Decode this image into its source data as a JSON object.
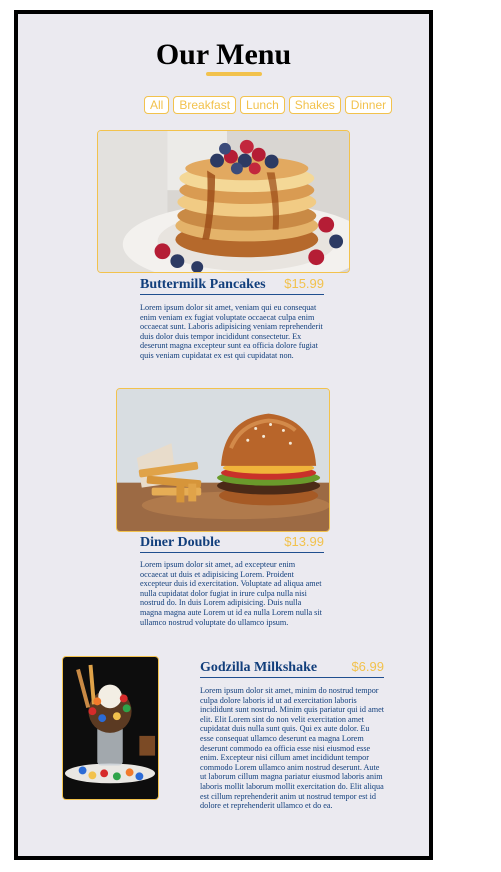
{
  "menu": {
    "title": "Our Menu",
    "filters": [
      "All",
      "Breakfast",
      "Lunch",
      "Shakes",
      "Dinner"
    ],
    "items": [
      {
        "name": "Buttermilk Pancakes",
        "price": "$15.99",
        "image": "pancakes-photo",
        "description": "Lorem ipsum dolor sit amet, veniam qui eu consequat enim veniam ex fugiat voluptate occaecat culpa enim occaecat sunt. Laboris adipisicing veniam reprehenderit duis dolor duis tempor incididunt consectetur. Ex deserunt magna excepteur sunt ea officia dolore fugiat quis veniam cupidatat ex est qui cupidatat non."
      },
      {
        "name": "Diner Double",
        "price": "$13.99",
        "image": "burger-photo",
        "description": "Lorem ipsum dolor sit amet, ad excepteur enim occaecat ut duis et adipisicing Lorem. Proident excepteur duis id exercitation. Voluptate ad aliqua amet nulla cupidatat dolor fugiat in irure culpa nulla nisi nostrud do. In duis Lorem adipisicing. Duis nulla magna magna aute Lorem ut id ea nulla Lorem nulla sit ullamco nostrud voluptate do ullamco ipsum."
      },
      {
        "name": "Godzilla Milkshake",
        "price": "$6.99",
        "image": "milkshake-photo",
        "description": "Lorem ipsum dolor sit amet, minim do nostrud tempor culpa dolore laboris id ut ad exercitation laboris incididunt sunt nostrud. Minim quis pariatur qui id amet elit. Elit Lorem sint do non velit exercitation amet cupidatat duis nulla sunt quis. Qui ex aute dolor. Eu esse consequat ullamco deserunt ea magna Lorem deserunt commodo ea officia esse nisi eiusmod esse enim. Excepteur nisi cillum amet incididunt tempor commodo Lorem ullamco anim nostrud deserunt. Aute ut laborum cillum magna pariatur eiusmod laboris anim laboris mollit laborum mollit exercitation do. Elit aliqua est cillum reprehenderit anim ut nostrud tempor est id dolore et reprehenderit ullamco et do ea."
      }
    ]
  },
  "colors": {
    "accent": "#f2c24d",
    "text": "#123f7c",
    "background": "#ebeaf0",
    "border": "#000000"
  }
}
